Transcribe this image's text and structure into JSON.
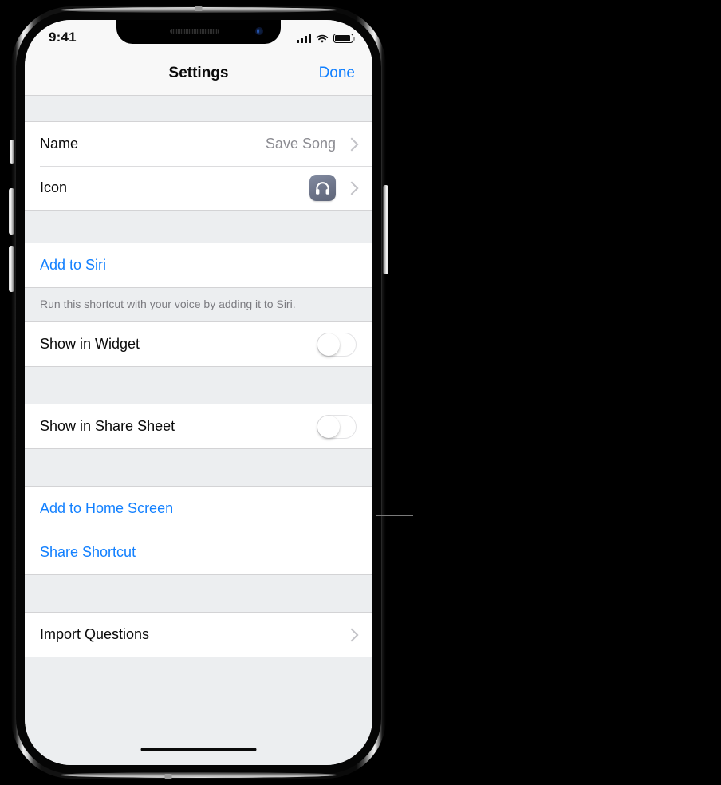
{
  "status_bar": {
    "time": "9:41",
    "signal_icon": "cellular-signal-icon",
    "wifi_icon": "wifi-icon",
    "battery_icon": "battery-full-icon"
  },
  "nav_bar": {
    "title": "Settings",
    "done_label": "Done"
  },
  "sections": [
    {
      "rows": [
        {
          "label": "Name",
          "value": "Save Song",
          "type": "disclosure"
        },
        {
          "label": "Icon",
          "value": "",
          "type": "icon-disclosure",
          "icon": "headphones-icon"
        }
      ]
    },
    {
      "rows": [
        {
          "label": "Add to Siri",
          "type": "link"
        }
      ],
      "footer": "Run this shortcut with your voice by adding it to Siri."
    },
    {
      "rows": [
        {
          "label": "Show in Widget",
          "type": "toggle",
          "on": false
        }
      ]
    },
    {
      "rows": [
        {
          "label": "Show in Share Sheet",
          "type": "toggle",
          "on": false
        }
      ]
    },
    {
      "rows": [
        {
          "label": "Add to Home Screen",
          "type": "link"
        },
        {
          "label": "Share Shortcut",
          "type": "link"
        }
      ]
    },
    {
      "rows": [
        {
          "label": "Import Questions",
          "type": "disclosure"
        }
      ]
    }
  ],
  "colors": {
    "accent_blue": "#1280ff",
    "group_background": "#ffffff",
    "page_background": "#eceef0",
    "secondary_text": "#8c8c92",
    "icon_tile": "#6d7489",
    "separator": "#dcdcde"
  },
  "device": {
    "home_indicator": "home-indicator",
    "notch": "notch",
    "buttons": [
      "silent-switch",
      "volume-up-button",
      "volume-down-button",
      "power-button"
    ]
  },
  "annotation": {
    "callout_line": "callout-leader-line"
  }
}
